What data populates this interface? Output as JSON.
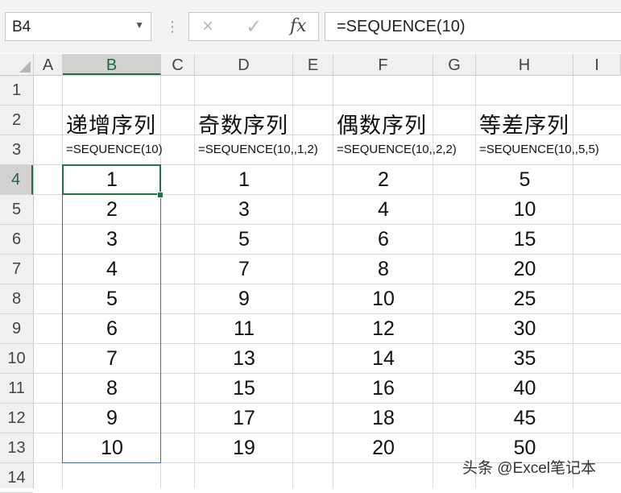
{
  "name_box": "B4",
  "formula_bar": {
    "cancel_icon": "×",
    "enter_icon": "✓",
    "fx_label": "fx",
    "formula": "=SEQUENCE(10)"
  },
  "columns": [
    "A",
    "B",
    "C",
    "D",
    "E",
    "F",
    "G",
    "H",
    "I"
  ],
  "rows": [
    "1",
    "2",
    "3",
    "4",
    "5",
    "6",
    "7",
    "8",
    "9",
    "10",
    "11",
    "12",
    "13",
    "14"
  ],
  "sheet": {
    "headers": {
      "B": "递增序列",
      "D": "奇数序列",
      "F": "偶数序列",
      "H": "等差序列"
    },
    "formulas": {
      "B": "=SEQUENCE(10)",
      "D": "=SEQUENCE(10,,1,2)",
      "F": "=SEQUENCE(10,,2,2)",
      "H": "=SEQUENCE(10,,5,5)"
    },
    "values": {
      "B": [
        "1",
        "2",
        "3",
        "4",
        "5",
        "6",
        "7",
        "8",
        "9",
        "10"
      ],
      "D": [
        "1",
        "3",
        "5",
        "7",
        "9",
        "11",
        "13",
        "15",
        "17",
        "19"
      ],
      "F": [
        "2",
        "4",
        "6",
        "8",
        "10",
        "12",
        "14",
        "16",
        "18",
        "20"
      ],
      "H": [
        "5",
        "10",
        "15",
        "20",
        "25",
        "30",
        "35",
        "40",
        "45",
        "50"
      ]
    }
  },
  "watermark": "头条 @Excel笔记本"
}
